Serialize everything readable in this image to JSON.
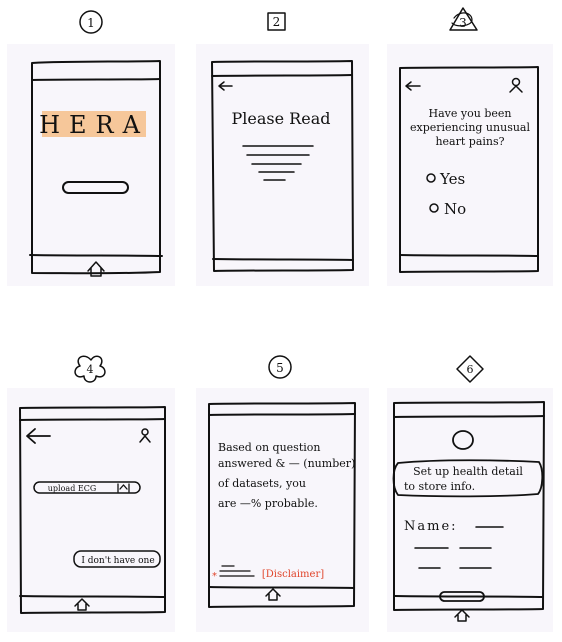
{
  "colors": {
    "card_bg": "#f8f6fb",
    "ink": "#111111",
    "highlight": "#f6c79a",
    "disclaimer_red": "#e0442a"
  },
  "sketches": [
    {
      "number": "1",
      "badge_shape": "circle",
      "title": "HERA",
      "nav_icon": "home-icon"
    },
    {
      "number": "2",
      "badge_shape": "square",
      "title": "Please Read",
      "nav_icon": "back-arrow-icon"
    },
    {
      "number": "3",
      "badge_shape": "triangle-scribble",
      "question_lines": [
        "Have you been",
        "experiencing unusual",
        "heart pains?"
      ],
      "options": [
        "Yes",
        "No"
      ],
      "nav_icon": "back-arrow-icon"
    },
    {
      "number": "4",
      "badge_shape": "flower",
      "upload_label": "upload ECG",
      "no_file_label": "I don't have one",
      "nav_icon": "back-arrow-icon"
    },
    {
      "number": "5",
      "badge_shape": "circle",
      "result_lines": [
        "Based on question",
        "answered & — (number)",
        "of datasets, you",
        "are —% probable."
      ],
      "disclaimer_label": "[Disclaimer]"
    },
    {
      "number": "6",
      "badge_shape": "diamond",
      "setup_lines": [
        "Set up health detail",
        "to store info."
      ],
      "name_label": "Name:"
    }
  ]
}
